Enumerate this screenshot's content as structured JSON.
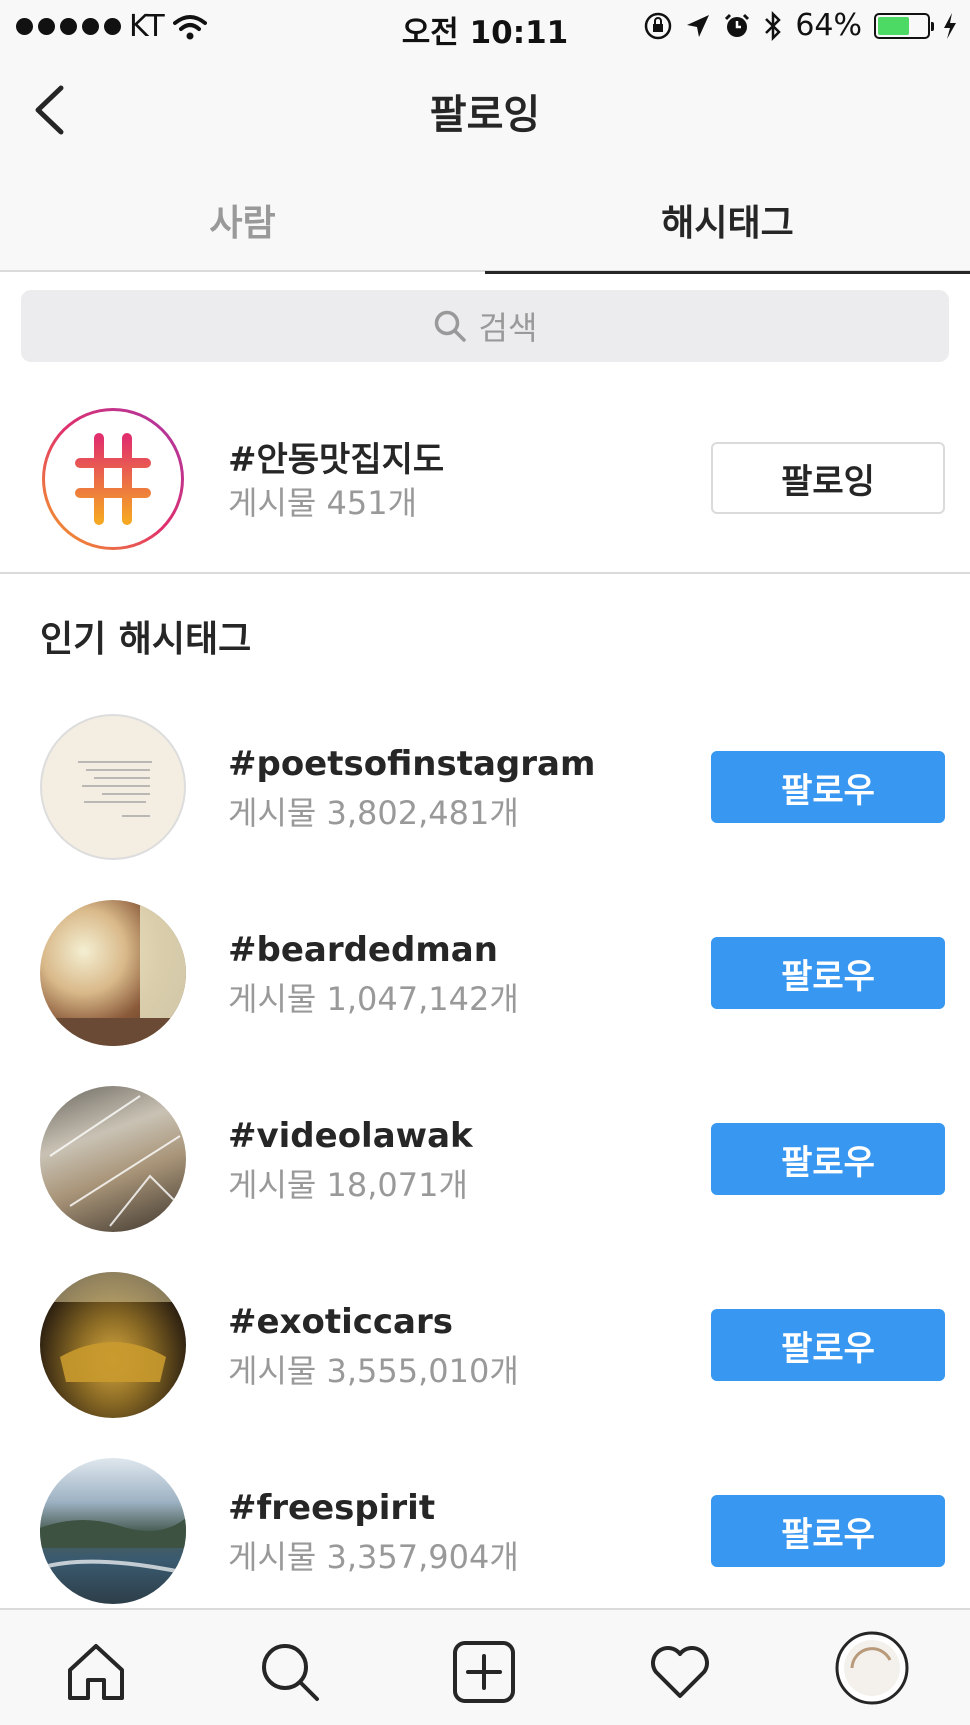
{
  "status_bar": {
    "carrier": "KT",
    "time": "오전 10:11",
    "battery": "64%",
    "battery_level": 0.64,
    "battery_color": "#4cd964"
  },
  "header": {
    "title": "팔로잉",
    "back_icon": "chevron-left-icon",
    "tabs": [
      {
        "label": "사람",
        "active": false
      },
      {
        "label": "해시태그",
        "active": true
      }
    ]
  },
  "search": {
    "placeholder": "검색",
    "icon": "search-icon"
  },
  "followed": {
    "tag": "#안동맛집지도",
    "count": "게시물 451개",
    "button": "팔로잉"
  },
  "popular": {
    "title": "인기 해시태그",
    "items": [
      {
        "tag": "#poetsofinstagram",
        "count": "게시물 3,802,481개",
        "button": "팔로우"
      },
      {
        "tag": "#beardedman",
        "count": "게시물 1,047,142개",
        "button": "팔로우"
      },
      {
        "tag": "#videolawak",
        "count": "게시물 18,071개",
        "button": "팔로우"
      },
      {
        "tag": "#exoticcars",
        "count": "게시물 3,555,010개",
        "button": "팔로우"
      },
      {
        "tag": "#freespirit",
        "count": "게시물 3,357,904개",
        "button": "팔로우"
      }
    ]
  },
  "tab_bar": {
    "items": [
      "home-icon",
      "search-icon",
      "add-icon",
      "heart-icon",
      "profile-icon"
    ]
  },
  "colors": {
    "accent": "#3897f0",
    "text": "#262626",
    "muted": "#999999"
  }
}
